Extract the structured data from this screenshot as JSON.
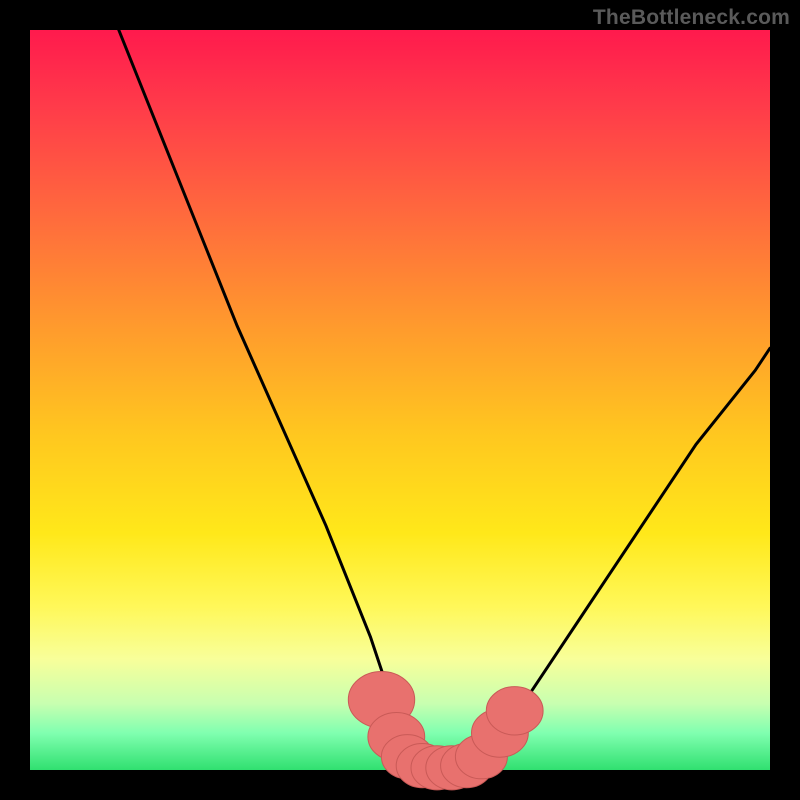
{
  "attribution": "TheBottleneck.com",
  "colors": {
    "frame": "#000000",
    "curve_stroke": "#000000",
    "marker_fill": "#e8716e",
    "marker_stroke": "#c95a57",
    "attribution_text": "#5a5a5a"
  },
  "chart_data": {
    "type": "line",
    "title": "",
    "xlabel": "",
    "ylabel": "",
    "xlim": [
      0,
      100
    ],
    "ylim": [
      0,
      100
    ],
    "grid": false,
    "legend": false,
    "background_gradient": [
      "#ff1a4d",
      "#ff9a2d",
      "#ffe81a",
      "#30e070"
    ],
    "series": [
      {
        "name": "curve",
        "x": [
          12,
          16,
          20,
          24,
          28,
          32,
          36,
          40,
          42,
          44,
          46,
          48,
          50,
          52,
          54,
          56,
          58,
          60,
          62,
          66,
          70,
          74,
          78,
          82,
          86,
          90,
          94,
          98,
          100
        ],
        "values": [
          100,
          90,
          80,
          70,
          60,
          51,
          42,
          33,
          28,
          23,
          18,
          12,
          6,
          3,
          1,
          0,
          0,
          1,
          3,
          8,
          14,
          20,
          26,
          32,
          38,
          44,
          49,
          54,
          57
        ]
      }
    ],
    "markers": [
      {
        "x": 47.5,
        "y": 9.5,
        "r": 2.8
      },
      {
        "x": 49.5,
        "y": 4.5,
        "r": 2.4
      },
      {
        "x": 51.0,
        "y": 1.8,
        "r": 2.2
      },
      {
        "x": 53.0,
        "y": 0.6,
        "r": 2.2
      },
      {
        "x": 55.0,
        "y": 0.3,
        "r": 2.2
      },
      {
        "x": 57.0,
        "y": 0.3,
        "r": 2.2
      },
      {
        "x": 59.0,
        "y": 0.6,
        "r": 2.2
      },
      {
        "x": 61.0,
        "y": 1.8,
        "r": 2.2
      },
      {
        "x": 63.5,
        "y": 5.0,
        "r": 2.4
      },
      {
        "x": 65.5,
        "y": 8.0,
        "r": 2.4
      }
    ]
  }
}
